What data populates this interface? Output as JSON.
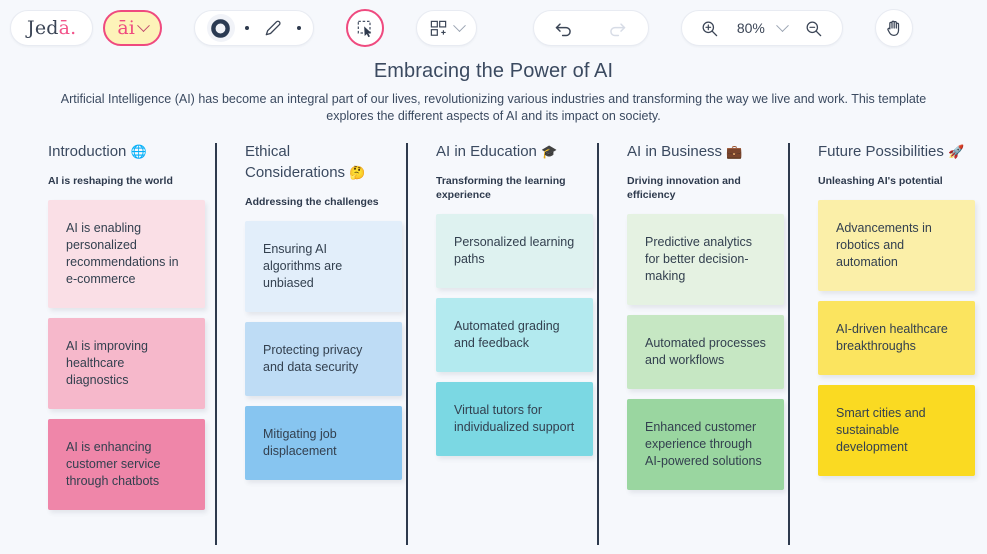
{
  "toolbar": {
    "logo": {
      "text_main": "Jed",
      "text_accent": "ā."
    },
    "ai_button": {
      "label": "āi",
      "icon": "chevron-down-icon"
    },
    "shape_tool": {
      "icon": "circle-shape-icon"
    },
    "pen_tool": {
      "icon": "pencil-icon"
    },
    "select_tool": {
      "icon": "marquee-select-icon"
    },
    "frame_tool": {
      "icon": "grid-frame-icon"
    },
    "undo": {
      "icon": "undo-arrow-icon"
    },
    "redo": {
      "icon": "redo-arrow-icon"
    },
    "zoom_in": {
      "icon": "magnifier-plus-icon"
    },
    "zoom_out": {
      "icon": "magnifier-minus-icon"
    },
    "zoom_level": "80%",
    "hand_tool": {
      "icon": "hand-icon"
    },
    "accent_color": "#ef4a7f",
    "ai_fill_color": "#fdf3b9"
  },
  "document": {
    "title": "Embracing the Power of AI",
    "subtitle": "Artificial Intelligence (AI) has become an integral part of our lives, revolutionizing various industries and transforming the way we live and work. This template explores the different aspects of AI and its impact on society."
  },
  "columns": [
    {
      "heading": "Introduction",
      "emoji": "🌐",
      "emoji_name": "globe-icon",
      "subheading": "AI is reshaping the world",
      "cards": [
        {
          "text": "AI is enabling personalized recommendations in e-commerce",
          "color": "#fadfe6"
        },
        {
          "text": "AI is improving healthcare diagnostics",
          "color": "#f6b8cb"
        },
        {
          "text": "AI is enhancing customer service through chatbots",
          "color": "#ef86a9"
        }
      ]
    },
    {
      "heading": "Ethical Considerations",
      "emoji": "🤔",
      "emoji_name": "thinking-face-icon",
      "subheading": "Addressing the challenges",
      "cards": [
        {
          "text": "Ensuring AI algorithms are unbiased",
          "color": "#e2eefa"
        },
        {
          "text": "Protecting privacy and data security",
          "color": "#bedcf5"
        },
        {
          "text": "Mitigating job displacement",
          "color": "#87c5f0"
        }
      ]
    },
    {
      "heading": "AI in Education",
      "emoji": "🎓",
      "emoji_name": "graduation-cap-icon",
      "subheading": "Transforming the learning experience",
      "cards": [
        {
          "text": "Personalized learning paths",
          "color": "#def2f0"
        },
        {
          "text": "Automated grading and feedback",
          "color": "#b3eaef"
        },
        {
          "text": "Virtual tutors for individualized support",
          "color": "#7bd8e3"
        }
      ]
    },
    {
      "heading": "AI in Business",
      "emoji": "💼",
      "emoji_name": "briefcase-icon",
      "subheading": "Driving innovation and efficiency",
      "cards": [
        {
          "text": "Predictive analytics for better decision-making",
          "color": "#e5f2e2"
        },
        {
          "text": "Automated processes and workflows",
          "color": "#c6e7c3"
        },
        {
          "text": "Enhanced customer experience through AI-powered solutions",
          "color": "#9ad6a0"
        }
      ]
    },
    {
      "heading": "Future Possibilities",
      "emoji": "🚀",
      "emoji_name": "rocket-icon",
      "subheading": "Unleashing AI's potential",
      "cards": [
        {
          "text": "Advancements in robotics and automation",
          "color": "#fbefa8"
        },
        {
          "text": "AI-driven healthcare breakthroughs",
          "color": "#fbe45f"
        },
        {
          "text": "Smart cities and sustainable development",
          "color": "#fada22"
        }
      ]
    }
  ]
}
